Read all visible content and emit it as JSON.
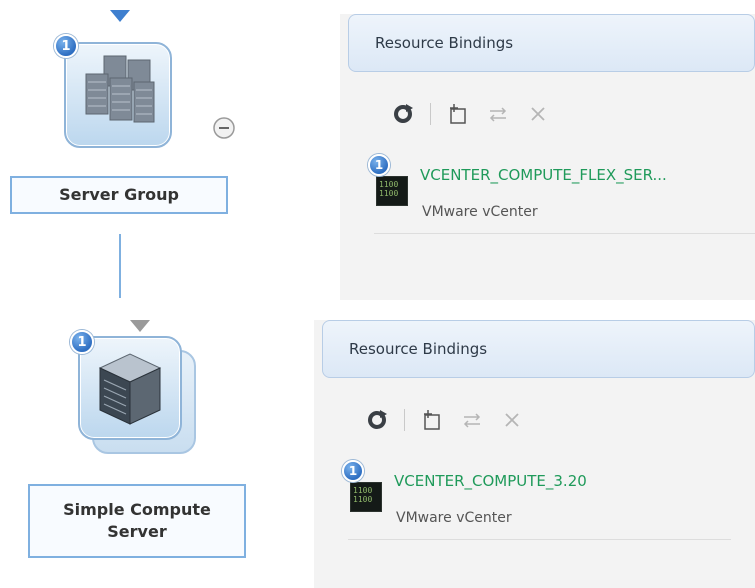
{
  "tree": {
    "nodes": [
      {
        "label": "Server Group",
        "badge": "1",
        "icon": "server-rack-cluster-icon"
      },
      {
        "label": "Simple Compute Server",
        "badge": "1",
        "icon": "server-cube-icon"
      }
    ],
    "collapse_icon": "minus-circle-icon"
  },
  "panels": [
    {
      "header": "Resource Bindings",
      "toolbar": [
        "refresh-icon",
        "add-binding-icon",
        "swap-icon",
        "delete-icon"
      ],
      "binding": {
        "badge": "1",
        "title": "VCENTER_COMPUTE_FLEX_SER...",
        "subtitle": "VMware vCenter",
        "icon_text": "1100\n1100"
      }
    },
    {
      "header": "Resource Bindings",
      "toolbar": [
        "refresh-icon",
        "add-binding-icon",
        "swap-icon",
        "delete-icon"
      ],
      "binding": {
        "badge": "1",
        "title": "VCENTER_COMPUTE_3.20",
        "subtitle": "VMware vCenter",
        "icon_text": "1100\n1100"
      }
    }
  ],
  "colors": {
    "accent_blue": "#7fb0e0",
    "binding_title_green": "#1f9a5a",
    "header_bg": "#dce8f6"
  }
}
